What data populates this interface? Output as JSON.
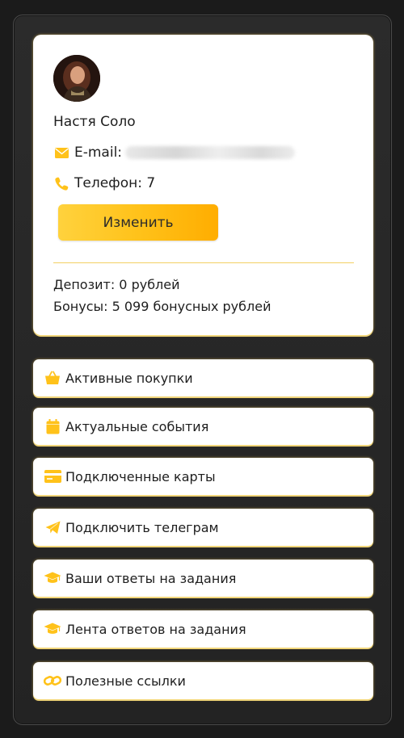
{
  "profile": {
    "name": "Настя Соло",
    "email_label": "E-mail:",
    "phone_label": "Телефон: 7",
    "edit_button": "Изменить",
    "deposit": "Депозит: 0 рублей",
    "bonuses": "Бонусы: 5 099 бонусных рублей"
  },
  "menu": [
    {
      "label": "Активные покупки",
      "icon": "basket-icon"
    },
    {
      "label": "Актуальные события",
      "icon": "calendar-icon"
    },
    {
      "label": "Подключенные карты",
      "icon": "credit-card-icon"
    },
    {
      "label": "Подключить телеграм",
      "icon": "telegram-icon"
    },
    {
      "label": "Ваши ответы на задания",
      "icon": "graduation-cap-icon"
    },
    {
      "label": "Лента ответов на задания",
      "icon": "graduation-cap-icon"
    },
    {
      "label": "Полезные ссылки",
      "icon": "link-icon"
    }
  ],
  "colors": {
    "accent": "#ffc21a",
    "background": "#1b1b1b",
    "card": "#ffffff"
  }
}
